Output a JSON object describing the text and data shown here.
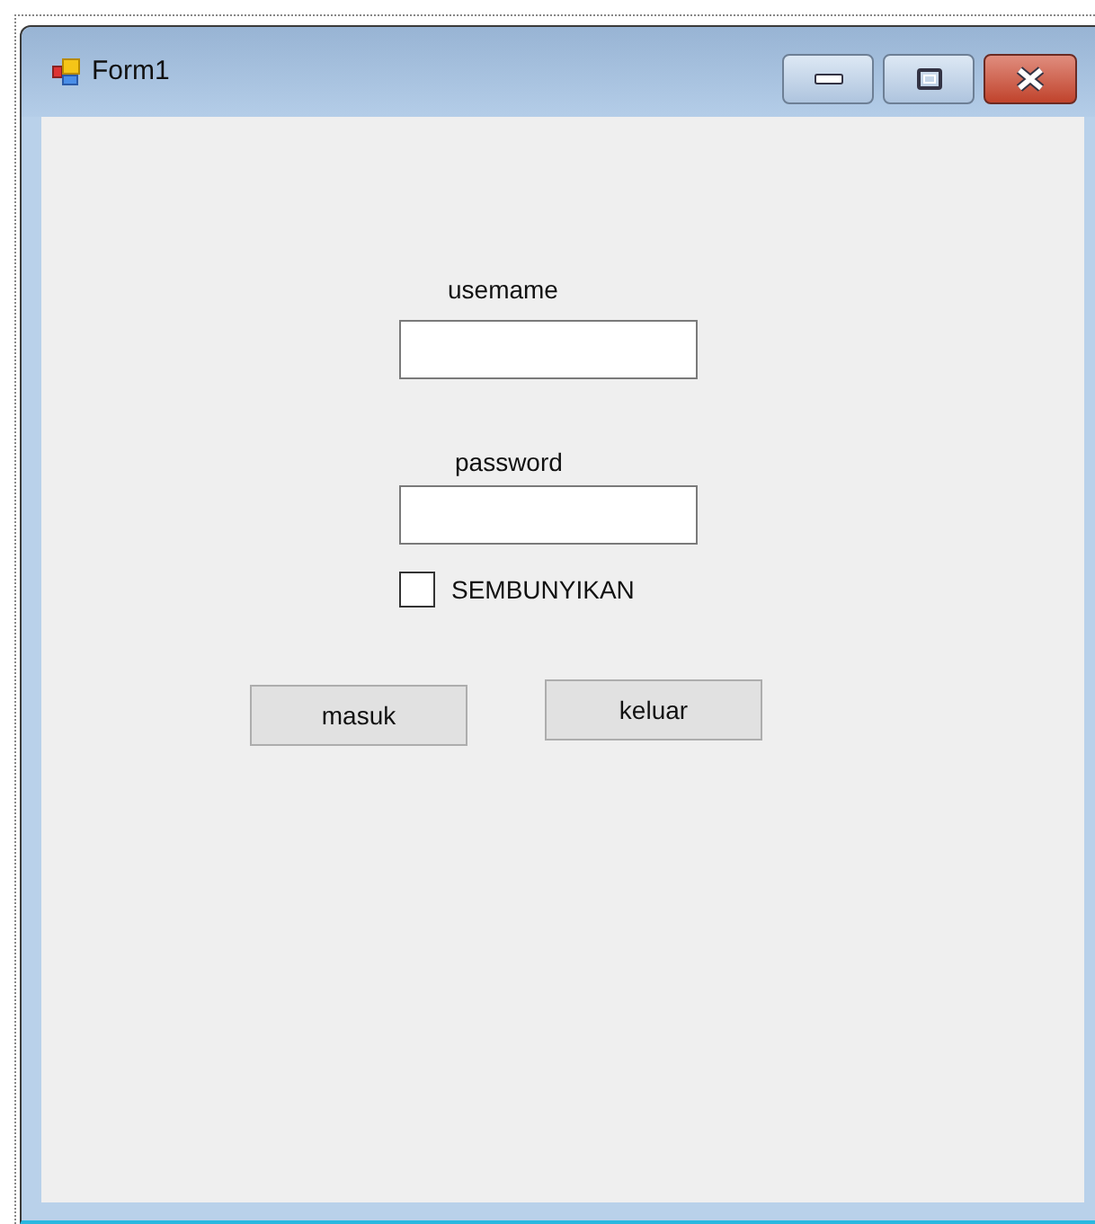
{
  "window": {
    "title": "Form1"
  },
  "fields": [
    {
      "label": "usemame"
    },
    {
      "label": "password"
    }
  ],
  "checkbox": {
    "label": "SEMBUNYIKAN",
    "checked": false
  },
  "buttons": [
    "masuk",
    "keluar"
  ]
}
